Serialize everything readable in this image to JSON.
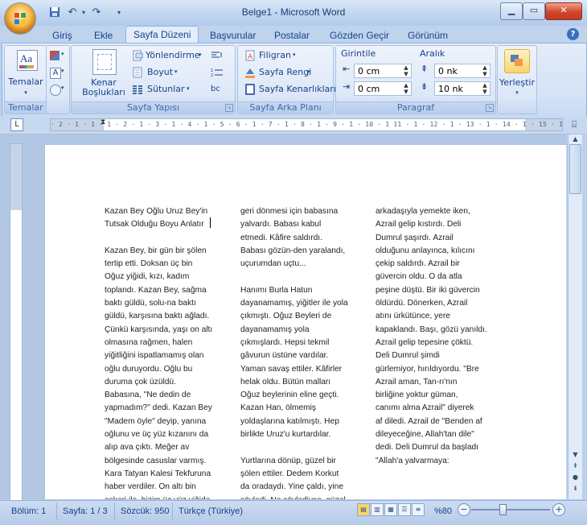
{
  "window": {
    "title": "Belge1 - Microsoft Word"
  },
  "tabs": [
    "Giriş",
    "Ekle",
    "Sayfa Düzeni",
    "Başvurular",
    "Postalar",
    "Gözden Geçir",
    "Görünüm"
  ],
  "ribbon": {
    "temalar": {
      "button": "Temalar",
      "group": "Temalar"
    },
    "sayfa_yapisi": {
      "kenar": [
        "Kenar",
        "Boşlukları"
      ],
      "yonlendirme": "Yönlendirme",
      "boyut": "Boyut",
      "sutunlar": "Sütunlar",
      "group": "Sayfa Yapısı",
      "hyphen_glyph": "bc"
    },
    "arka_plani": {
      "filigran": "Filigran",
      "sayfa_rengi": "Sayfa Rengi",
      "kenarliklar": "Sayfa Kenarlıkları",
      "group": "Sayfa Arka Planı"
    },
    "paragraf": {
      "girinti": "Girintile",
      "aralik": "Aralık",
      "girinti_sol": "0 cm",
      "girinti_sag": "0 cm",
      "aralik_once": "0 nk",
      "aralik_sonra": "10 nk",
      "group": "Paragraf"
    },
    "yerlestir": {
      "label": "Yerleştir"
    }
  },
  "ruler": {
    "ticks": "· 2 · 1 · 1 · 1 · 2 · 1 · 3 · 1 · 4 · 1 · 5 · 6 · 1 · 7 · 1 · 8 · 1 · 9 · 1 · 10 · 1 11 · 1 · 12 · 1 · 13 · 1 · 14 · 1 · 15 · 1 · 16 · 1 · 17 · 1 · 18 ·"
  },
  "document": {
    "col1": [
      [
        "Kazan Bey Oğlu Uruz Bey'in",
        "Tutsak Olduğu Boyu Anlatır"
      ],
      [
        "Kazan Bey, bir gün bir şölen",
        "tertip etti. Doksan üç bin",
        "Oğuz yiğidi, kızı, kadım",
        "toplandı. Kazan Bey, sağma",
        "baktı güldü, solu-na baktı",
        "güldü, karşısına baktı ağladı.",
        "Çünkü karşısında, yaşı on altı",
        "olmasına rağmen, halen",
        "yiğitliğini ispatlamamış olan",
        "oğlu duruyordu.  Oğlu bu",
        "duruma çok üzüldü.",
        "Babasına, \"Ne dedin de",
        "yapmadım?\" dedi. Kazan Bey",
        "\"Madem öyle\" deyip, yanına",
        "oğlunu ve üç yüz kızanını da",
        "alıp ava çıktı. Meğer av",
        "bölgesinde casuslar varmış.",
        "Kara Tatyan Kalesi Tekfuruna",
        "haber verdiler. On altı bin",
        "askeri ile, bizim üç yüz yiğide"
      ]
    ],
    "col2": [
      [
        "geri dönmesi için babasına",
        "yalvardı. Babası kabul",
        "etmedi. Kâfire saldırdı.",
        "Babası gözün-den yaralandı,",
        "uçurumdan uçtu..."
      ],
      [
        "Hanımı Burla Hatun",
        "dayanamamış, yiğitler ile yola",
        "çıkmıştı. Oğuz Beyleri de",
        "dayanamamış yola",
        "çıkmışlardı. Hepsi tekmil",
        "gâvurun üstüne vardılar.",
        "Yaman savaş ettiler. Kâfirler",
        "helak oldu. Bütün malları",
        "Oğuz beylerinin eline geçti.",
        "Kazan Han, ölmemiş",
        "yoldaşlarına katılmıştı. Hep",
        "birlikte Uruz'u kurtardılar."
      ],
      [
        "Yurtlarına dönüp, güzel bir",
        "şölen ettiler. Dedem Korkut",
        "da oradaydı. Yine çaldı, yine",
        "söyledi. Ne söylediyse, güzel"
      ]
    ],
    "col3": [
      [
        "arkadaşıyla yemekte iken,",
        "Azrail gelip kıstırdı. Deli",
        "Dumrul şaşırdı. Azrail",
        "olduğunu anlayınca, kılıcını",
        "çekip saldırdı. Azrail bir",
        "güvercin oldu. O da atla",
        "peşine düştü. Bir iki güvercin",
        "öldürdü. Dönerken,  Azrail",
        "atını ürkütünce, yere",
        "kapaklandı. Başı, gözü yanıldı.",
        "Azrail gelip tepesine çöktü.",
        "Deli Dumrul şimdi",
        "gürlemiyor, hırıldıyordu. \"Bre",
        "Azrail aman, Tan-rı'nın",
        "birliğine yoktur güman,",
        "canımı alma Azrail\" diyerek",
        "af diledi. Azrail de \"Benden af",
        "dileyeceğine, Allah'tan dile\"",
        "dedi. Deli Dumrul da başladı",
        "\"Allah'a yalvarmaya:"
      ]
    ]
  },
  "status": {
    "bolum": "Bölüm: 1",
    "sayfa": "Sayfa: 1 / 3",
    "sozcuk": "Sözcük: 950",
    "dil": "Türkçe (Türkiye)",
    "zoom": "%80"
  },
  "colors": {
    "ribbon_bg": "#dce7f7",
    "accent": "#15428b",
    "close": "#d1462c"
  },
  "icons": [
    "office-button",
    "save-icon",
    "undo-icon",
    "redo-icon",
    "minimize-icon",
    "maximize-icon",
    "close-icon",
    "help-icon"
  ]
}
